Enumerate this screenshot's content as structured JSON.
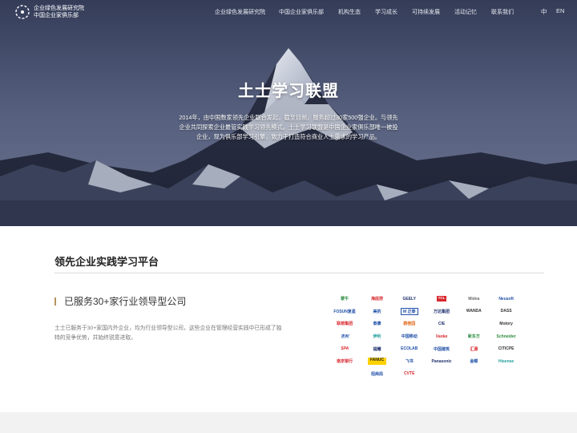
{
  "header": {
    "logo_line1": "企业绿色发展研究院",
    "logo_line2": "中国企业家俱乐部",
    "nav": [
      "企业绿色发展研究院",
      "中国企业家俱乐部",
      "机构生态",
      "学习成长",
      "可持续发展",
      "活动记忆",
      "联系我们"
    ],
    "lang_zh": "中",
    "lang_en": "EN"
  },
  "hero": {
    "title": "土士学习联盟",
    "description": "2014年，由中国数家领先企业联合发起。截至目前，服务超过30家500强企业。与领先企业共同探索企业最管实践学习领先模式。土士学习联盟是中国企业家俱乐部唯一被投企业，现为俱乐部学习引擎，致力于打造符合商业人士需求的学习产品。"
  },
  "section": {
    "title": "领先企业实践学习平台",
    "subtitle": "已服务30+家行业领导型公司",
    "description": "土士已服务于30+家国内外企业，均为行业领导型公司，这些企业在管理经营实践中已形成了独特的竞争优势，并始终锐意进取。"
  },
  "brands": [
    [
      "蒙牛",
      "海底捞",
      "GEELY",
      "TCL",
      "Midea",
      "Neusoft"
    ],
    [
      "FOSUN复星",
      "美的",
      "M 正泰",
      "万达集团",
      "WANDA",
      "DASS"
    ],
    [
      "联想集团",
      "泰康",
      "碧桂园",
      "CIE",
      "",
      "Motory"
    ],
    [
      "吉利",
      "伊利",
      "中国移动",
      "Vanke",
      "新东方",
      "Schneider"
    ],
    [
      "SPA",
      "福耀",
      "ECOLAB",
      "中国建筑",
      "汇源",
      "CITICPE"
    ],
    [
      "南京银行",
      "FANUC",
      "飞书",
      "Panasonic",
      "金蝶",
      "Hisense"
    ],
    [
      "",
      "招商局",
      "CVTE",
      "",
      "",
      ""
    ]
  ],
  "colors": {
    "hero_dark": "#3c4460",
    "accent_gold": "#b6935a",
    "footer_band": "#f2f2f2"
  }
}
